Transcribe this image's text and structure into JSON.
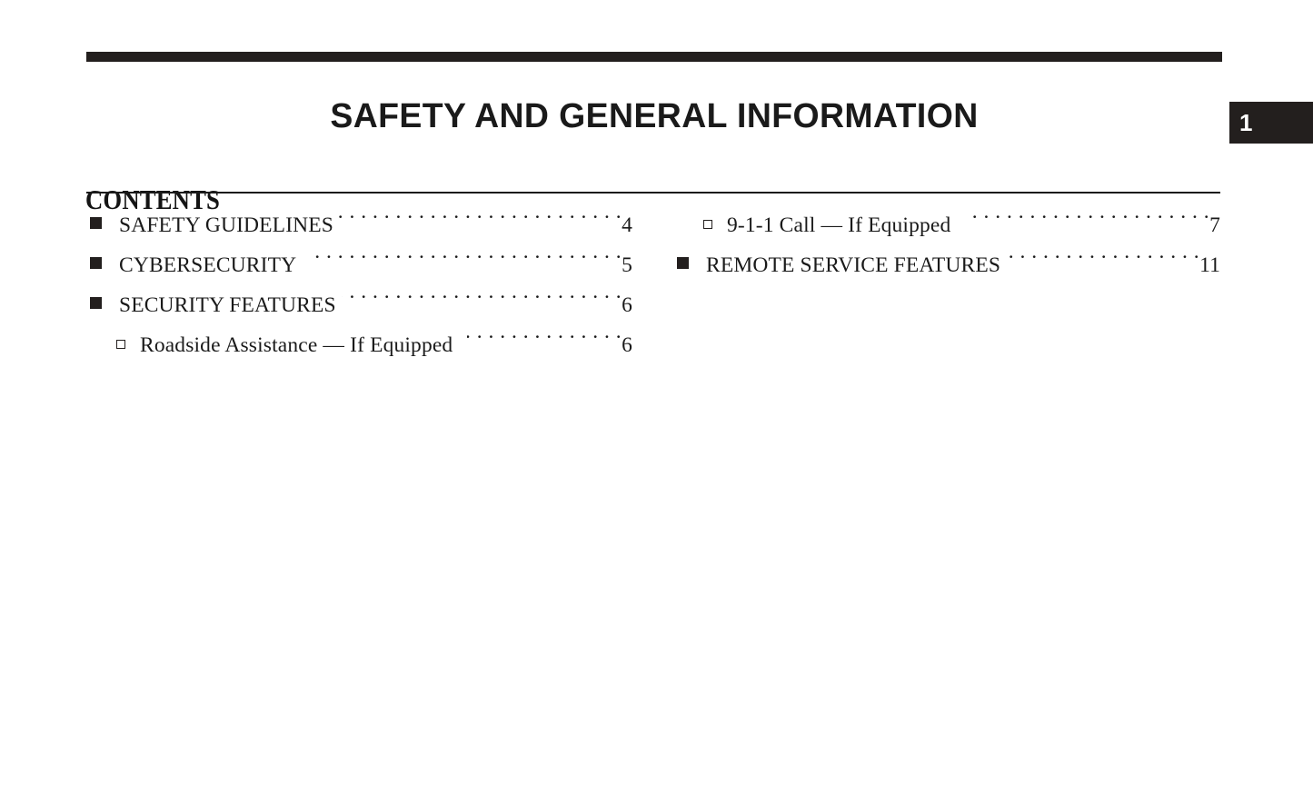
{
  "chapter": {
    "tab_number": "1",
    "title": "SAFETY AND GENERAL INFORMATION"
  },
  "contents": {
    "heading": "CONTENTS",
    "left_column": [
      {
        "marker": "filled-square",
        "label": "SAFETY GUIDELINES",
        "page": "4"
      },
      {
        "marker": "filled-square",
        "label": "CYBERSECURITY",
        "page": "5"
      },
      {
        "marker": "filled-square",
        "label": "SECURITY FEATURES",
        "page": "6"
      },
      {
        "marker": "hollow-square",
        "label": "Roadside Assistance — If Equipped",
        "page": "6"
      }
    ],
    "right_column": [
      {
        "marker": "hollow-square",
        "label": "9-1-1 Call — If Equipped",
        "page": "7"
      },
      {
        "marker": "filled-square",
        "label": "REMOTE SERVICE FEATURES",
        "page": "11"
      }
    ]
  },
  "colors": {
    "ink": "#231f1e",
    "page_background": "#ffffff",
    "tab_text": "#ffffff"
  }
}
